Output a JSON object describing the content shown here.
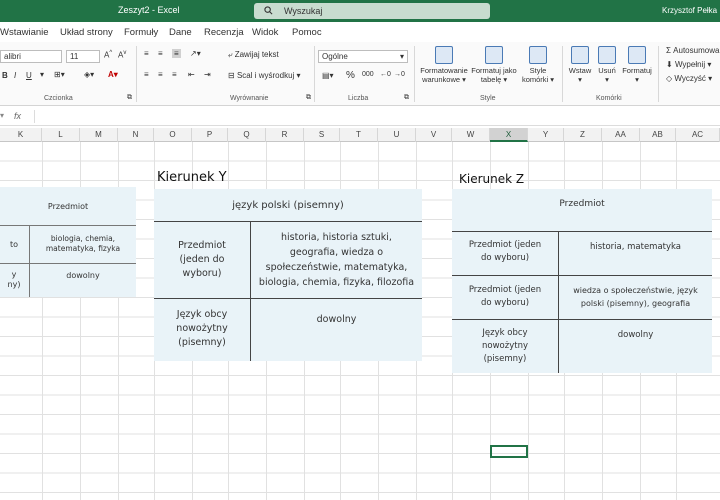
{
  "titlebar": {
    "file": "Zeszyt2 - Excel",
    "search_placeholder": "Wyszukaj",
    "user": "Krzysztof Pełka"
  },
  "tabs": [
    "Wstawianie",
    "Układ strony",
    "Formuły",
    "Dane",
    "Recenzja",
    "Widok",
    "Pomoc"
  ],
  "ribbon": {
    "font_name": "alibri",
    "font_size": "11",
    "wrap": "Zawijaj tekst",
    "merge": "Scal i wyśrodkuj",
    "number_format": "Ogólne",
    "cond_format": "Formatowanie\nwarunkowe",
    "format_table": "Formatuj jako\ntabelę",
    "cell_styles": "Style\nkomórki",
    "insert": "Wstaw",
    "delete": "Usuń",
    "format": "Formatuj",
    "autosum": "Autosumowa",
    "fill": "Wypełnij",
    "clear": "Wyczyść",
    "group_font": "Czcionka",
    "group_align": "Wyrównanie",
    "group_number": "Liczba",
    "group_styles": "Style",
    "group_cells": "Komórki"
  },
  "formula_bar": {
    "fx": "fx"
  },
  "columns": [
    "K",
    "L",
    "M",
    "N",
    "O",
    "P",
    "Q",
    "R",
    "S",
    "T",
    "U",
    "V",
    "W",
    "X",
    "Y",
    "Z",
    "AA",
    "AB",
    "AC"
  ],
  "left_table": {
    "header": "Przedmiot",
    "r1_left": "to",
    "r1_right": "biologia, chemia,\nmatematyka, fizyka",
    "r2_left": "y\nny)",
    "r2_right": "dowolny"
  },
  "table_y": {
    "heading": "Kierunek Y",
    "header": "język polski (pisemny)",
    "r1_left": "Przedmiot\n(jeden do\nwyboru)",
    "r1_right": "historia, historia sztuki,\ngeografia, wiedza o\nspołeczeństwie, matematyka,\nbiologia, chemia, fizyka, filozofia",
    "r2_left": "Język obcy\nnowożytny\n(pisemny)",
    "r2_right": "dowolny"
  },
  "table_z": {
    "heading": "Kierunek Z",
    "header": "Przedmiot",
    "r1_left": "Przedmiot (jeden\ndo wyboru)",
    "r1_right": "historia, matematyka",
    "r2_left": "Przedmiot (jeden\ndo wyboru)",
    "r2_right": "wiedza o społeczeństwie, język\npolski (pisemny), geografia",
    "r3_left": "Język obcy\nnowożytny\n(pisemny)",
    "r3_right": "dowolny"
  }
}
